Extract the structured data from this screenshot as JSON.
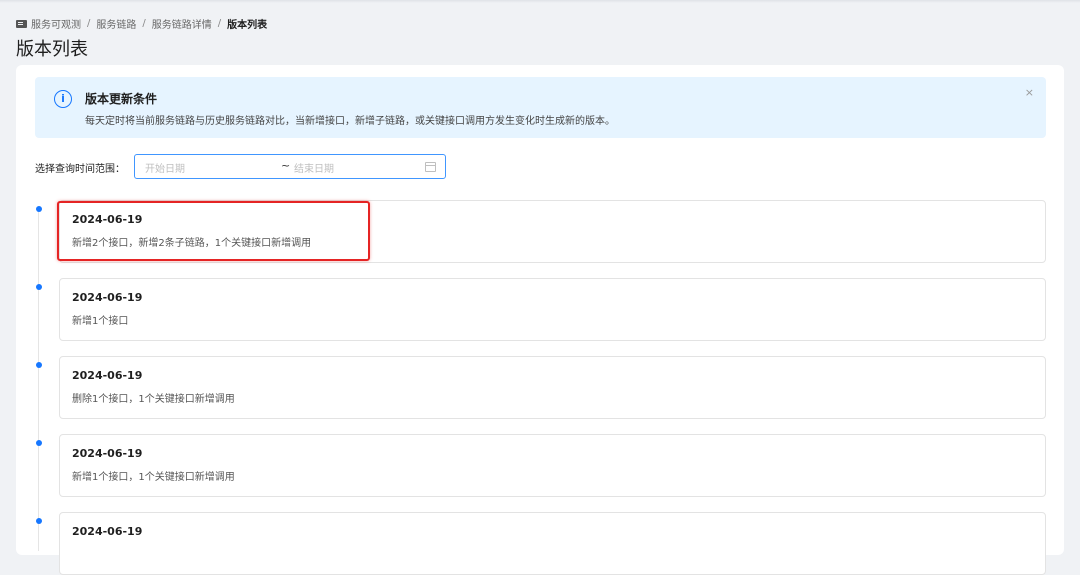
{
  "breadcrumb": {
    "items": [
      "服务可观测",
      "服务链路",
      "服务链路详情",
      "版本列表"
    ],
    "separator": "/"
  },
  "page_title": "版本列表",
  "alert": {
    "title": "版本更新条件",
    "description": "每天定时将当前服务链路与历史服务链路对比，当新增接口，新增子链路，或关键接口调用方发生变化时生成新的版本。",
    "info_glyph": "i",
    "close_glyph": "×"
  },
  "filter": {
    "label": "选择查询时间范围：",
    "start_placeholder": "开始日期",
    "range_separator": "~",
    "end_placeholder": "结束日期"
  },
  "versions": [
    {
      "date": "2024-06-19",
      "desc": "新增2个接口，新增2条子链路，1个关键接口新增调用"
    },
    {
      "date": "2024-06-19",
      "desc": "新增1个接口"
    },
    {
      "date": "2024-06-19",
      "desc": "删除1个接口，1个关键接口新增调用"
    },
    {
      "date": "2024-06-19",
      "desc": "新增1个接口，1个关键接口新增调用"
    },
    {
      "date": "2024-06-19",
      "desc": ""
    }
  ],
  "colors": {
    "accent": "#1677ff",
    "alert_bg": "#e6f4ff",
    "highlight": "#e52424"
  }
}
